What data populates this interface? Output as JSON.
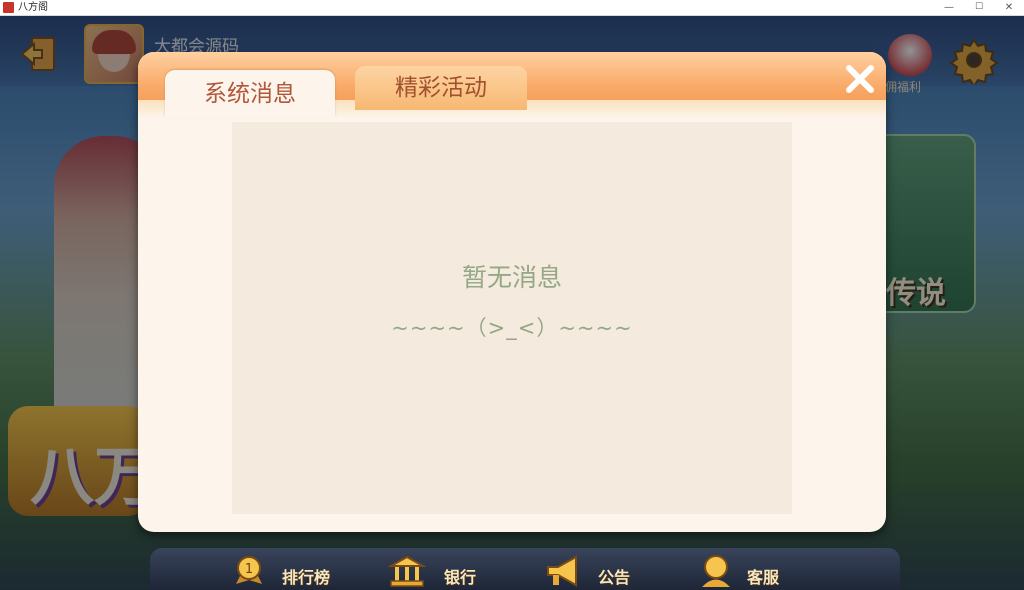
{
  "window": {
    "title": "八方阁",
    "minimize": "—",
    "maximize": "☐",
    "close": "✕"
  },
  "header": {
    "username": "大都会源码",
    "welfare_label": "佣福利"
  },
  "logo_text": "八万",
  "side_card": {
    "label": "传说"
  },
  "dialog": {
    "tabs": [
      {
        "label": "系统消息",
        "active": true
      },
      {
        "label": "精彩活动",
        "active": false
      }
    ],
    "empty_title": "暂无消息",
    "empty_face": "~~~~（>_<）~~~~"
  },
  "bottom_nav": [
    {
      "label": "排行榜",
      "icon": "trophy-medal-icon",
      "badge": "1"
    },
    {
      "label": "银行",
      "icon": "bank-icon"
    },
    {
      "label": "公告",
      "icon": "megaphone-icon"
    },
    {
      "label": "客服",
      "icon": "customer-service-icon"
    }
  ],
  "colors": {
    "header_orange": "#f9a866",
    "tab_text": "#b0563a",
    "empty_text": "#94a886",
    "panel_bg": "#f4ebde",
    "dialog_bg": "#fdf5eb"
  }
}
